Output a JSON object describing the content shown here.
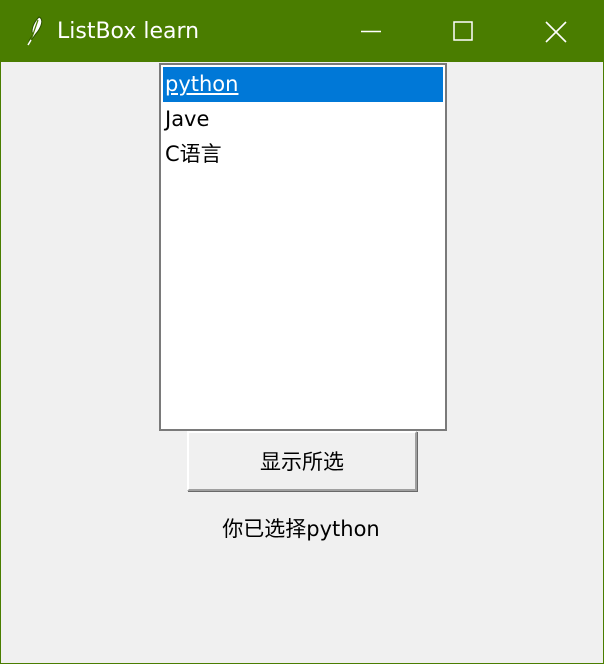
{
  "window": {
    "title": "ListBox learn",
    "app_icon": "feather-icon",
    "controls": {
      "minimize": "minimize-icon",
      "maximize": "maximize-icon",
      "close": "close-icon"
    },
    "titlebar_color": "#4a7d00"
  },
  "listbox": {
    "items": [
      {
        "label": "python",
        "selected": true
      },
      {
        "label": "Jave",
        "selected": false
      },
      {
        "label": "C语言",
        "selected": false
      }
    ],
    "selection_color": "#0078d7"
  },
  "button": {
    "label": "显示所选"
  },
  "result": {
    "text": "你已选择python"
  }
}
